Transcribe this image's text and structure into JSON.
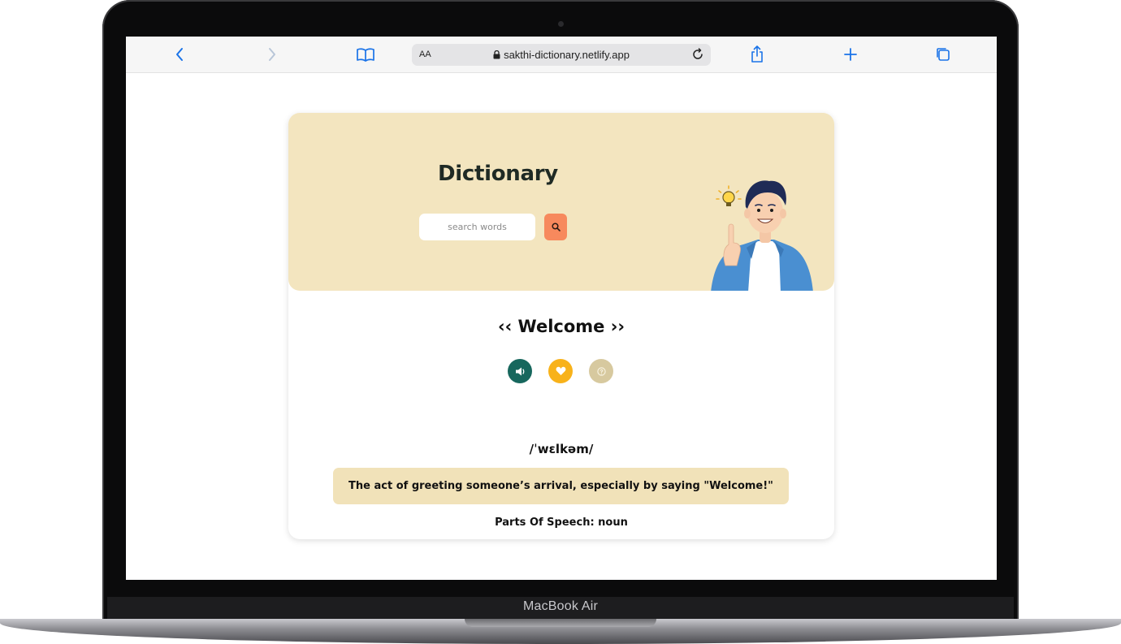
{
  "device": {
    "brand_label": "MacBook Air"
  },
  "browser": {
    "text_size_label": "AA",
    "url": "sakthi-dictionary.netlify.app",
    "back_icon": "chevron-left-icon",
    "forward_icon": "chevron-right-icon",
    "bookmarks_icon": "book-icon",
    "reload_icon": "reload-icon",
    "share_icon": "share-icon",
    "new_tab_icon": "plus-icon",
    "tabs_icon": "tabs-icon"
  },
  "app": {
    "title": "Dictionary",
    "search": {
      "placeholder": "search words",
      "value": ""
    },
    "search_button_icon": "search-icon",
    "word_display": "‹‹ Welcome ››",
    "actions": [
      "speaker-icon",
      "heart-icon",
      "info-icon"
    ],
    "phonetic": "/ˈwɛlkəm/",
    "definition": "The act of greeting someone’s arrival, especially by saying \"Welcome!\"",
    "part_of_speech": "Parts Of Speech: noun"
  },
  "colors": {
    "hero_bg": "#f3e5bf",
    "search_button": "#f7895d",
    "speak_button": "#17675d",
    "favorite_button": "#f8b21a",
    "info_button": "#d7c99f",
    "browser_accent": "#1a73e8"
  }
}
